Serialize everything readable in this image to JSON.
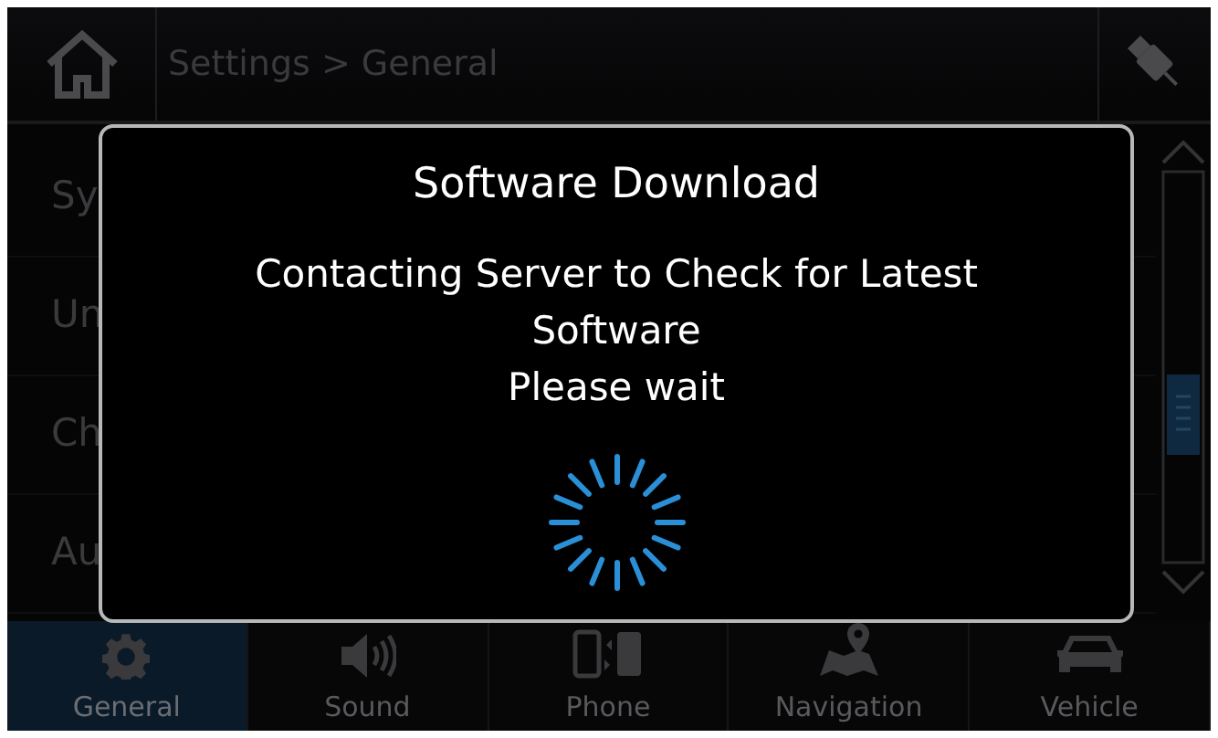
{
  "header": {
    "breadcrumb": "Settings > General"
  },
  "list": {
    "items": [
      "Sy",
      "Un",
      "Ch",
      "Au"
    ]
  },
  "dialog": {
    "title": "Software Download",
    "message": "Contacting Server to Check for Latest Software",
    "status": "Please wait"
  },
  "tabs": [
    {
      "label": "General",
      "selected": true
    },
    {
      "label": "Sound",
      "selected": false
    },
    {
      "label": "Phone",
      "selected": false
    },
    {
      "label": "Navigation",
      "selected": false
    },
    {
      "label": "Vehicle",
      "selected": false
    }
  ]
}
